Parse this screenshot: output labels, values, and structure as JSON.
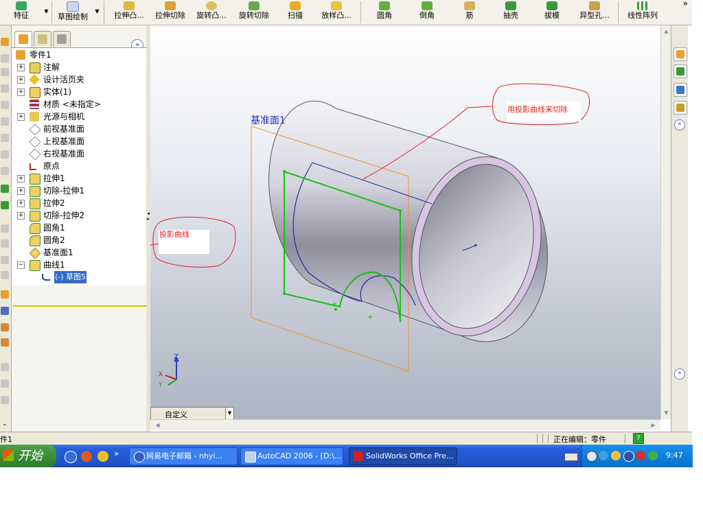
{
  "toolbar": {
    "features_label": "特征",
    "sketch_label": "草图绘制",
    "buttons": [
      "拉伸凸...",
      "拉伸切除",
      "旋转凸...",
      "旋转切除",
      "扫描",
      "放样凸...",
      "圆角",
      "倒角",
      "筋",
      "抽壳",
      "拔模",
      "异型孔...",
      "线性阵列"
    ],
    "more": "»"
  },
  "tree_panel": {
    "collapse": "»",
    "items": [
      {
        "label": "零件1",
        "expand": ""
      },
      {
        "label": "注解",
        "expand": "+"
      },
      {
        "label": "设计活页夹",
        "expand": "+"
      },
      {
        "label": "实体(1)",
        "expand": "+"
      },
      {
        "label": "材质 <未指定>",
        "expand": ""
      },
      {
        "label": "光源与相机",
        "expand": "+"
      },
      {
        "label": "前视基准面",
        "expand": ""
      },
      {
        "label": "上视基准面",
        "expand": ""
      },
      {
        "label": "右视基准面",
        "expand": ""
      },
      {
        "label": "原点",
        "expand": ""
      },
      {
        "label": "拉伸1",
        "expand": "+"
      },
      {
        "label": "切除-拉伸1",
        "expand": "+"
      },
      {
        "label": "拉伸2",
        "expand": "+"
      },
      {
        "label": "切除-拉伸2",
        "expand": "+"
      },
      {
        "label": "圆角1",
        "expand": ""
      },
      {
        "label": "圆角2",
        "expand": ""
      },
      {
        "label": "基准面1",
        "expand": ""
      },
      {
        "label": "曲线1",
        "expand": "−"
      },
      {
        "label": "(-) 草图5",
        "expand": ""
      }
    ]
  },
  "viewport": {
    "plane_label": "基准面1",
    "annotation_top": "用投影曲线来切除",
    "annotation_left": "投影曲线",
    "triad": {
      "z": "Z",
      "x": "X",
      "y": "Y"
    }
  },
  "view_dropdown": {
    "value": "自定义"
  },
  "status": {
    "left": "件1",
    "editing": "正在编辑：零件",
    "help": "?"
  },
  "taskbar": {
    "start": "开始",
    "ql_more": "»",
    "tasks": [
      "网易电子邮箱 - nhyi...",
      "AutoCAD 2006 - [D:\\...",
      "SolidWorks Office Pre..."
    ],
    "clock": "9:47"
  },
  "colors": {
    "sketch_green": "#18c018",
    "curve_blue": "#1a2aa8",
    "plane_orange": "#f09030",
    "annotation_red": "#e02020",
    "selection": "#316ac5"
  }
}
